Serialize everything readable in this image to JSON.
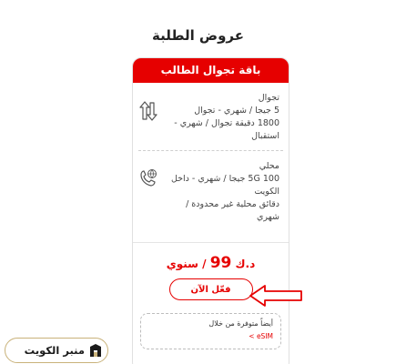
{
  "page": {
    "title": "عروض الطلبة"
  },
  "card": {
    "header": "باقة تجوال الطالب",
    "features": [
      {
        "icon": "roaming-arrows-icon",
        "lines": [
          "تجوال",
          "5 جيجا / شهري - تجوال",
          "1800 دقيقة تجوال / شهري -",
          "استقبال"
        ]
      },
      {
        "icon": "phone-globe-icon",
        "lines": [
          "محلي",
          "100 5G جيجا / شهري - داخل",
          "الكويت",
          "دقائق محلية غير محدودة /",
          "شهري"
        ]
      }
    ],
    "price": {
      "currency": "د.ك",
      "amount": "99",
      "period": "/ سنوي"
    },
    "cta_label": "فعّل الآن",
    "esim": {
      "text": "أيضاً متوفرة من خلال",
      "link": "eSIM >"
    }
  },
  "watermark": {
    "text": "منبر الكويت"
  },
  "colors": {
    "accent": "#e60000",
    "watermark_border": "#c9b27a"
  }
}
